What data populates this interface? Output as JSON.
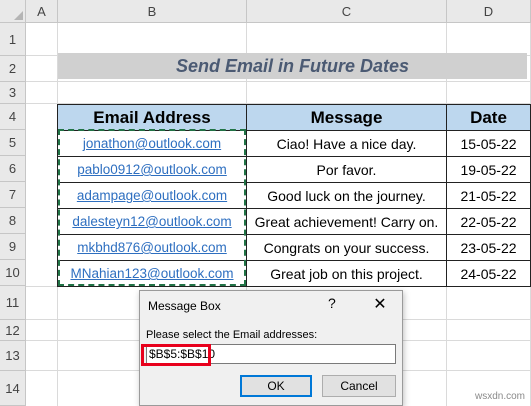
{
  "columns": [
    "A",
    "B",
    "C",
    "D"
  ],
  "rows": [
    "1",
    "2",
    "3",
    "4",
    "5",
    "6",
    "7",
    "8",
    "9",
    "10",
    "11",
    "12",
    "13",
    "14"
  ],
  "title": "Send Email in Future Dates",
  "table": {
    "headers": [
      "Email Address",
      "Message",
      "Date"
    ],
    "rows": [
      {
        "email": "jonathon@outlook.com",
        "message": "Ciao! Have a nice day.",
        "date": "15-05-22"
      },
      {
        "email": "pablo0912@outlook.com",
        "message": "Por favor.",
        "date": "19-05-22"
      },
      {
        "email": "adampage@outlook.com",
        "message": "Good luck on the journey.",
        "date": "21-05-22"
      },
      {
        "email": "dalesteyn12@outlook.com",
        "message": "Great achievement! Carry on.",
        "date": "22-05-22"
      },
      {
        "email": "mkbhd876@outlook.com",
        "message": "Congrats on your success.",
        "date": "23-05-22"
      },
      {
        "email": "MNahian123@outlook.com",
        "message": "Great job on this project.",
        "date": "24-05-22"
      }
    ]
  },
  "dialog": {
    "title": "Message Box",
    "help": "?",
    "close": "✕",
    "prompt": "Please select the Email addresses:",
    "input_value": "$B$5:$B$10",
    "ok_label": "OK",
    "cancel_label": "Cancel"
  },
  "watermark": "wsxdn.com",
  "colors": {
    "header_fill": "#bdd7ee",
    "title_text": "#4b5a73",
    "link": "#2e6fc0",
    "selection_border": "#217346",
    "highlight": "#e8001c"
  }
}
